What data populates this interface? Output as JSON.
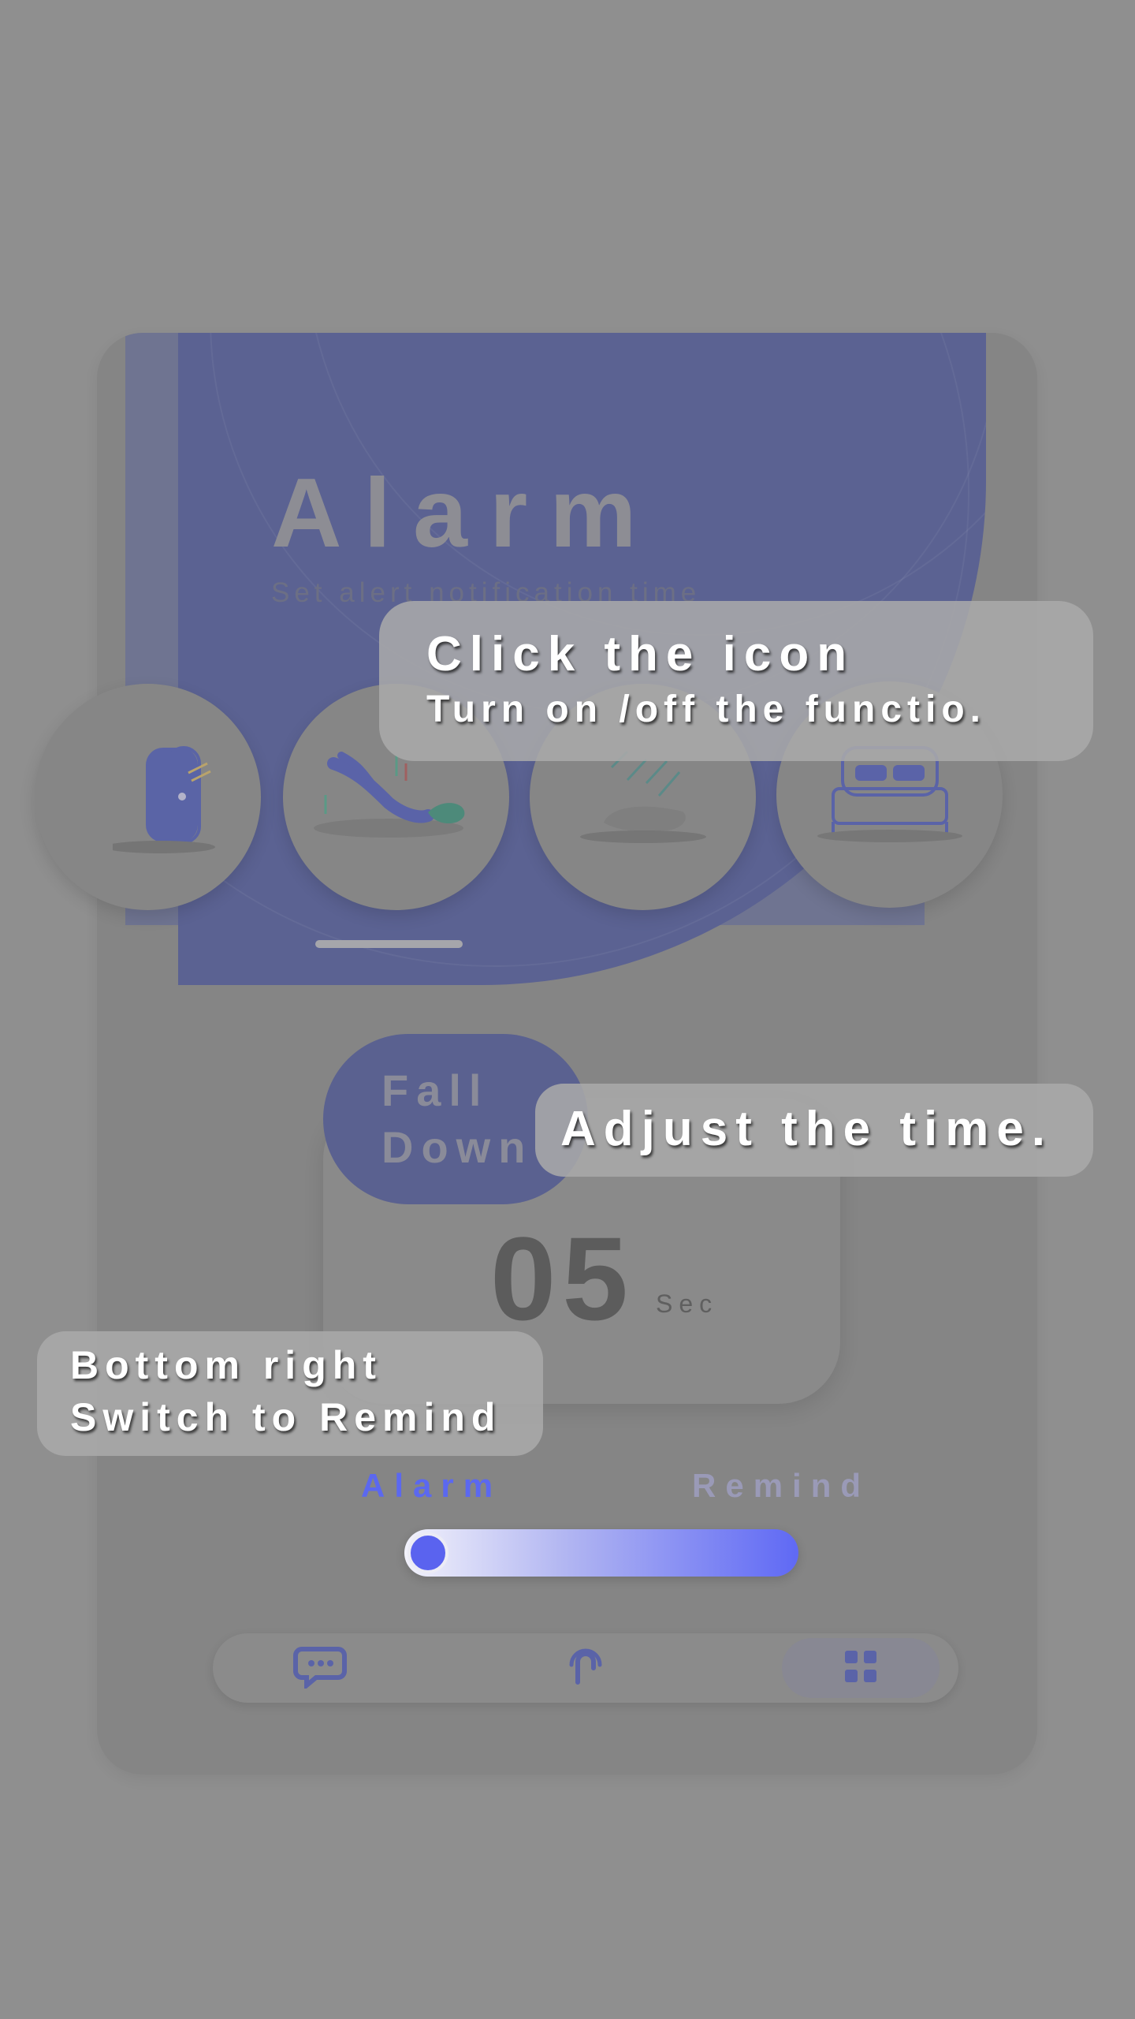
{
  "header": {
    "title": "Alarm",
    "subtitle": "Set alert notification time"
  },
  "functions": [
    {
      "name": "door",
      "icon": "door-icon"
    },
    {
      "name": "fall-down",
      "icon": "person-falling-icon"
    },
    {
      "name": "rain",
      "icon": "rain-cloud-icon"
    },
    {
      "name": "bed",
      "icon": "bed-icon"
    }
  ],
  "selected_function": {
    "label": "Fall\nDown"
  },
  "timer": {
    "value": "05",
    "unit": "Sec"
  },
  "mode_switch": {
    "left_label": "Alarm",
    "right_label": "Remind",
    "position": 0
  },
  "bottom_nav": [
    {
      "icon": "chat-icon"
    },
    {
      "icon": "touch-icon"
    },
    {
      "icon": "grid-icon"
    }
  ],
  "tips": {
    "icon_tip": {
      "line1": "Click the icon",
      "line2": "Turn on /off the functio."
    },
    "time_tip": {
      "line1": "Adjust the time."
    },
    "switch_tip": {
      "line1": "Bottom right",
      "line2": "Switch to Remind"
    }
  },
  "colors": {
    "accent": "#5b68f0",
    "header": "#5b6292",
    "overlay": "#8f8f8f"
  }
}
